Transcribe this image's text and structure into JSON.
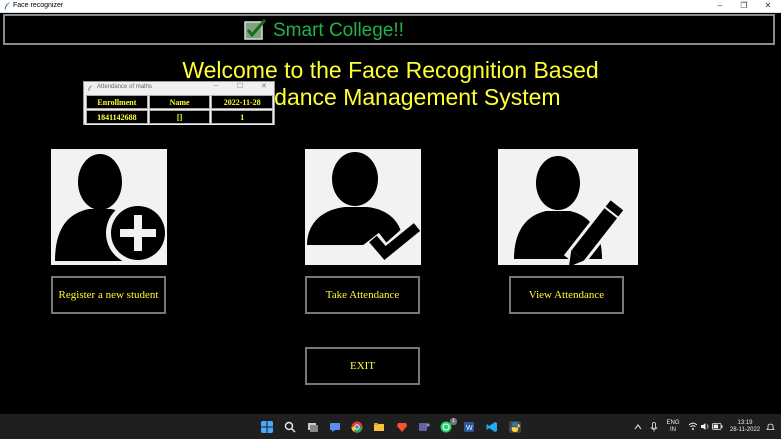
{
  "window": {
    "title": "Face recognizer",
    "minimize": "–",
    "maximize": "❐",
    "close": "✕"
  },
  "header": {
    "brand": "Smart College!!"
  },
  "welcome": {
    "line1": "Welcome to the Face Recognition Based",
    "line2": "Attendance Management System"
  },
  "popup": {
    "title": "Attendance of maths",
    "controls": {
      "minimize": "–",
      "maximize": "☐",
      "close": "✕"
    },
    "columns": [
      "Enrollment",
      "Name",
      "2022-11-28"
    ],
    "rows": [
      [
        "1841142688",
        "[]",
        "1"
      ]
    ]
  },
  "buttons": {
    "register": "Register a new student",
    "take": "Take Attendance",
    "view": "View Attendance",
    "exit": "EXIT"
  },
  "taskbar": {
    "lang": "ENG",
    "region": "IN",
    "time": "13:19",
    "date": "28-11-2022",
    "badge": "1",
    "icons": [
      "windows-start-icon",
      "search-icon",
      "task-view-icon",
      "chat-icon",
      "chrome-icon",
      "file-explorer-icon",
      "brave-icon",
      "teams-icon",
      "whatsapp-icon",
      "word-icon",
      "vscode-icon",
      "python-icon"
    ]
  },
  "colors": {
    "accent_yellow": "#ffff33",
    "brand_green": "#22b14c",
    "tile_bg": "#f2f2f2",
    "button_border": "#777777"
  }
}
